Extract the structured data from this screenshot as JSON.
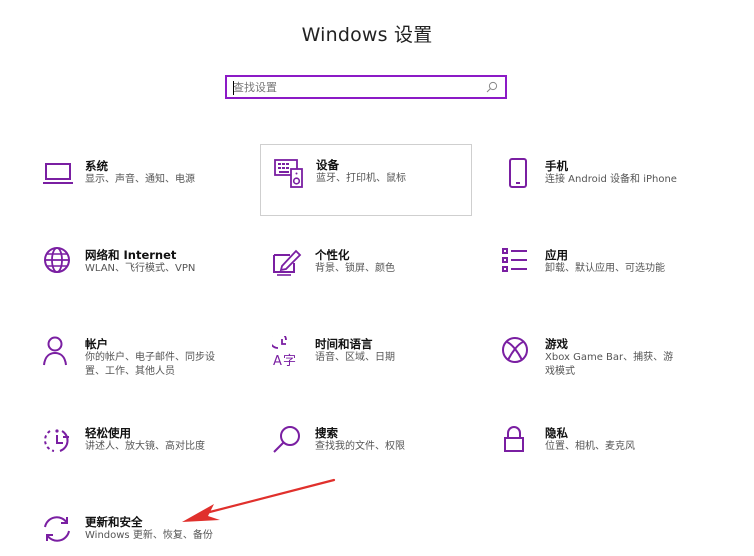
{
  "header": {
    "title": "Windows 设置"
  },
  "search": {
    "placeholder": "查找设置",
    "value": ""
  },
  "colors": {
    "accent": "#8c1ac6",
    "arrow": "#e0302c"
  },
  "tiles": [
    {
      "name": "系统",
      "desc": "显示、声音、通知、电源",
      "icon": "monitor-icon"
    },
    {
      "name": "设备",
      "desc": "蓝牙、打印机、鼠标",
      "icon": "keyboard-speaker-icon"
    },
    {
      "name": "手机",
      "desc": "连接 Android 设备和 iPhone",
      "icon": "phone-icon"
    },
    {
      "name": "网络和 Internet",
      "desc": "WLAN、飞行模式、VPN",
      "icon": "globe-icon"
    },
    {
      "name": "个性化",
      "desc": "背景、锁屏、颜色",
      "icon": "pen-tablet-icon"
    },
    {
      "name": "应用",
      "desc": "卸载、默认应用、可选功能",
      "icon": "app-list-icon"
    },
    {
      "name": "帐户",
      "desc": "你的帐户、电子邮件、同步设置、工作、其他人员",
      "icon": "person-icon"
    },
    {
      "name": "时间和语言",
      "desc": "语音、区域、日期",
      "icon": "time-language-icon"
    },
    {
      "name": "游戏",
      "desc": "Xbox Game Bar、捕获、游戏模式",
      "icon": "xbox-icon"
    },
    {
      "name": "轻松使用",
      "desc": "讲述人、放大镜、高对比度",
      "icon": "ease-of-access-icon"
    },
    {
      "name": "搜索",
      "desc": "查找我的文件、权限",
      "icon": "search-icon"
    },
    {
      "name": "隐私",
      "desc": "位置、相机、麦克风",
      "icon": "lock-icon"
    },
    {
      "name": "更新和安全",
      "desc": "Windows 更新、恢复、备份",
      "icon": "refresh-icon"
    }
  ]
}
